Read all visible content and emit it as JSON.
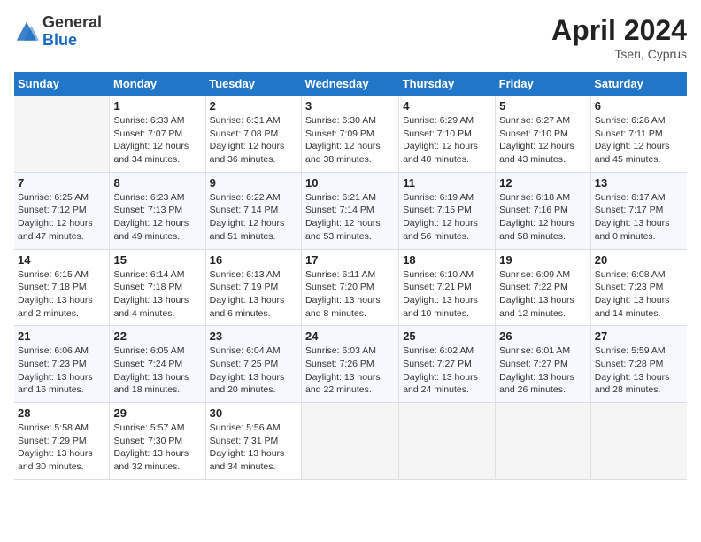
{
  "header": {
    "logo_general": "General",
    "logo_blue": "Blue",
    "month_title": "April 2024",
    "location": "Tseri, Cyprus"
  },
  "days_of_week": [
    "Sunday",
    "Monday",
    "Tuesday",
    "Wednesday",
    "Thursday",
    "Friday",
    "Saturday"
  ],
  "weeks": [
    [
      {
        "day": "",
        "empty": true
      },
      {
        "day": "1",
        "sunrise": "Sunrise: 6:33 AM",
        "sunset": "Sunset: 7:07 PM",
        "daylight": "Daylight: 12 hours and 34 minutes."
      },
      {
        "day": "2",
        "sunrise": "Sunrise: 6:31 AM",
        "sunset": "Sunset: 7:08 PM",
        "daylight": "Daylight: 12 hours and 36 minutes."
      },
      {
        "day": "3",
        "sunrise": "Sunrise: 6:30 AM",
        "sunset": "Sunset: 7:09 PM",
        "daylight": "Daylight: 12 hours and 38 minutes."
      },
      {
        "day": "4",
        "sunrise": "Sunrise: 6:29 AM",
        "sunset": "Sunset: 7:10 PM",
        "daylight": "Daylight: 12 hours and 40 minutes."
      },
      {
        "day": "5",
        "sunrise": "Sunrise: 6:27 AM",
        "sunset": "Sunset: 7:10 PM",
        "daylight": "Daylight: 12 hours and 43 minutes."
      },
      {
        "day": "6",
        "sunrise": "Sunrise: 6:26 AM",
        "sunset": "Sunset: 7:11 PM",
        "daylight": "Daylight: 12 hours and 45 minutes."
      }
    ],
    [
      {
        "day": "7",
        "sunrise": "Sunrise: 6:25 AM",
        "sunset": "Sunset: 7:12 PM",
        "daylight": "Daylight: 12 hours and 47 minutes."
      },
      {
        "day": "8",
        "sunrise": "Sunrise: 6:23 AM",
        "sunset": "Sunset: 7:13 PM",
        "daylight": "Daylight: 12 hours and 49 minutes."
      },
      {
        "day": "9",
        "sunrise": "Sunrise: 6:22 AM",
        "sunset": "Sunset: 7:14 PM",
        "daylight": "Daylight: 12 hours and 51 minutes."
      },
      {
        "day": "10",
        "sunrise": "Sunrise: 6:21 AM",
        "sunset": "Sunset: 7:14 PM",
        "daylight": "Daylight: 12 hours and 53 minutes."
      },
      {
        "day": "11",
        "sunrise": "Sunrise: 6:19 AM",
        "sunset": "Sunset: 7:15 PM",
        "daylight": "Daylight: 12 hours and 56 minutes."
      },
      {
        "day": "12",
        "sunrise": "Sunrise: 6:18 AM",
        "sunset": "Sunset: 7:16 PM",
        "daylight": "Daylight: 12 hours and 58 minutes."
      },
      {
        "day": "13",
        "sunrise": "Sunrise: 6:17 AM",
        "sunset": "Sunset: 7:17 PM",
        "daylight": "Daylight: 13 hours and 0 minutes."
      }
    ],
    [
      {
        "day": "14",
        "sunrise": "Sunrise: 6:15 AM",
        "sunset": "Sunset: 7:18 PM",
        "daylight": "Daylight: 13 hours and 2 minutes."
      },
      {
        "day": "15",
        "sunrise": "Sunrise: 6:14 AM",
        "sunset": "Sunset: 7:18 PM",
        "daylight": "Daylight: 13 hours and 4 minutes."
      },
      {
        "day": "16",
        "sunrise": "Sunrise: 6:13 AM",
        "sunset": "Sunset: 7:19 PM",
        "daylight": "Daylight: 13 hours and 6 minutes."
      },
      {
        "day": "17",
        "sunrise": "Sunrise: 6:11 AM",
        "sunset": "Sunset: 7:20 PM",
        "daylight": "Daylight: 13 hours and 8 minutes."
      },
      {
        "day": "18",
        "sunrise": "Sunrise: 6:10 AM",
        "sunset": "Sunset: 7:21 PM",
        "daylight": "Daylight: 13 hours and 10 minutes."
      },
      {
        "day": "19",
        "sunrise": "Sunrise: 6:09 AM",
        "sunset": "Sunset: 7:22 PM",
        "daylight": "Daylight: 13 hours and 12 minutes."
      },
      {
        "day": "20",
        "sunrise": "Sunrise: 6:08 AM",
        "sunset": "Sunset: 7:23 PM",
        "daylight": "Daylight: 13 hours and 14 minutes."
      }
    ],
    [
      {
        "day": "21",
        "sunrise": "Sunrise: 6:06 AM",
        "sunset": "Sunset: 7:23 PM",
        "daylight": "Daylight: 13 hours and 16 minutes."
      },
      {
        "day": "22",
        "sunrise": "Sunrise: 6:05 AM",
        "sunset": "Sunset: 7:24 PM",
        "daylight": "Daylight: 13 hours and 18 minutes."
      },
      {
        "day": "23",
        "sunrise": "Sunrise: 6:04 AM",
        "sunset": "Sunset: 7:25 PM",
        "daylight": "Daylight: 13 hours and 20 minutes."
      },
      {
        "day": "24",
        "sunrise": "Sunrise: 6:03 AM",
        "sunset": "Sunset: 7:26 PM",
        "daylight": "Daylight: 13 hours and 22 minutes."
      },
      {
        "day": "25",
        "sunrise": "Sunrise: 6:02 AM",
        "sunset": "Sunset: 7:27 PM",
        "daylight": "Daylight: 13 hours and 24 minutes."
      },
      {
        "day": "26",
        "sunrise": "Sunrise: 6:01 AM",
        "sunset": "Sunset: 7:27 PM",
        "daylight": "Daylight: 13 hours and 26 minutes."
      },
      {
        "day": "27",
        "sunrise": "Sunrise: 5:59 AM",
        "sunset": "Sunset: 7:28 PM",
        "daylight": "Daylight: 13 hours and 28 minutes."
      }
    ],
    [
      {
        "day": "28",
        "sunrise": "Sunrise: 5:58 AM",
        "sunset": "Sunset: 7:29 PM",
        "daylight": "Daylight: 13 hours and 30 minutes."
      },
      {
        "day": "29",
        "sunrise": "Sunrise: 5:57 AM",
        "sunset": "Sunset: 7:30 PM",
        "daylight": "Daylight: 13 hours and 32 minutes."
      },
      {
        "day": "30",
        "sunrise": "Sunrise: 5:56 AM",
        "sunset": "Sunset: 7:31 PM",
        "daylight": "Daylight: 13 hours and 34 minutes."
      },
      {
        "day": "",
        "empty": true
      },
      {
        "day": "",
        "empty": true
      },
      {
        "day": "",
        "empty": true
      },
      {
        "day": "",
        "empty": true
      }
    ]
  ]
}
